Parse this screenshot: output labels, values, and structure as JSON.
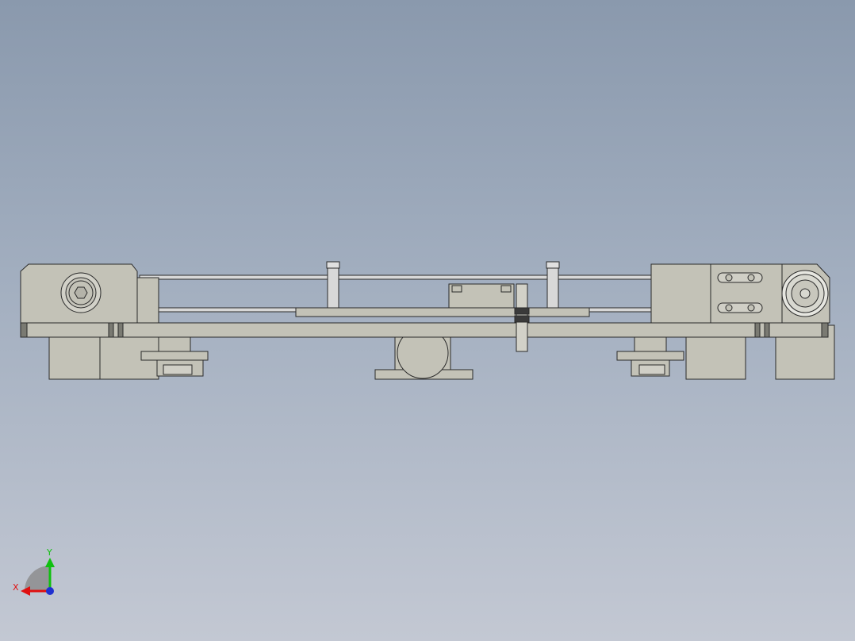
{
  "viewport": {
    "background_top": "#8a99ad",
    "background_bottom": "#c3c8d3"
  },
  "model": {
    "part_color": "#c3c2b7",
    "part_dark": "#a6a59b",
    "edge_color": "#2a2a2a",
    "shaft_color": "#d8d8d8"
  },
  "triad": {
    "x_label": "X",
    "y_label": "Y",
    "x_color": "#e01010",
    "y_color": "#10c010",
    "z_color": "#2030d0",
    "x_icon": "x-axis-arrow-icon",
    "y_icon": "y-axis-arrow-icon",
    "z_icon": "z-axis-dot-icon"
  }
}
